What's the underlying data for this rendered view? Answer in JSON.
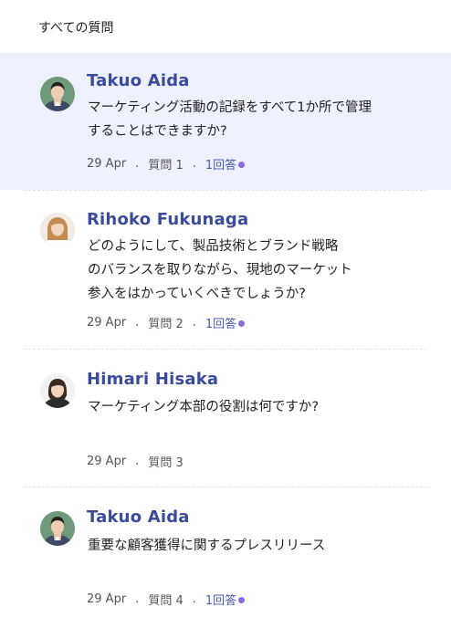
{
  "header": {
    "title": "すべての質問"
  },
  "questions": [
    {
      "author": "Takuo  Aida",
      "text_lines": [
        "マーケティング活動の記録をすべて1か所で管理",
        "することはできますか?"
      ],
      "date": "29 Apr",
      "question_label": "質問 1",
      "answers_label": "1回答",
      "has_answers": true,
      "active": true
    },
    {
      "author": "Rihoko Fukunaga",
      "text_lines": [
        "どのようにして、製品技術とブランド戦略",
        "のバランスを取りながら、現地のマーケット",
        "参入をはかっていくべきでしょうか?"
      ],
      "date": "29 Apr",
      "question_label": "質問 2",
      "answers_label": "1回答",
      "has_answers": true,
      "active": false
    },
    {
      "author": "Himari Hisaka",
      "text_lines": [
        "マーケティング本部の役割は何ですか?"
      ],
      "date": "29 Apr",
      "question_label": "質問 3",
      "answers_label": "",
      "has_answers": false,
      "active": false
    },
    {
      "author": "Takuo  Aida",
      "text_lines": [
        "重要な顧客獲得に関するプレスリリース"
      ],
      "date": "29 Apr",
      "question_label": "質問 4",
      "answers_label": "1回答",
      "has_answers": true,
      "active": false
    }
  ],
  "colors": {
    "accent": "#3b4b9c",
    "active_bg": "#eef0fc",
    "answer_dot": "#8a6ae0"
  }
}
